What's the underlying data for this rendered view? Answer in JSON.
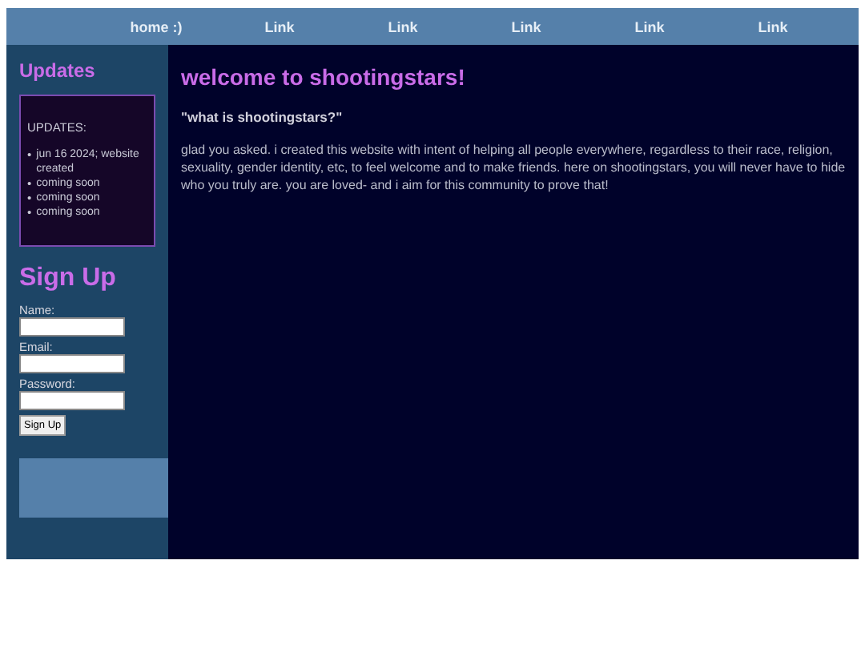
{
  "nav": {
    "links": [
      {
        "label": "home :)"
      },
      {
        "label": "Link"
      },
      {
        "label": "Link"
      },
      {
        "label": "Link"
      },
      {
        "label": "Link"
      },
      {
        "label": "Link"
      }
    ]
  },
  "sidebar": {
    "updates_title": "Updates",
    "updates_box": {
      "heading": "UPDATES:",
      "marker": "•",
      "items": [
        "jun 16 2024; website created",
        "coming soon",
        "coming soon",
        "coming soon"
      ]
    },
    "signup": {
      "title": "Sign Up",
      "fields": [
        {
          "label": "Name:"
        },
        {
          "label": "Email:"
        },
        {
          "label": "Password:"
        }
      ],
      "button": "Sign Up"
    }
  },
  "main": {
    "title": "welcome to shootingstars!",
    "subtitle": "\"what is shootingstars?\"",
    "paragraph": "glad you asked. i created this website with intent of helping all people everywhere, regardless to their race, religion, sexuality, gender identity, etc, to feel welcome and to make friends. here on shootingstars, you will never have to hide who you truly are. you are loved- and i aim for this community to prove that!"
  }
}
